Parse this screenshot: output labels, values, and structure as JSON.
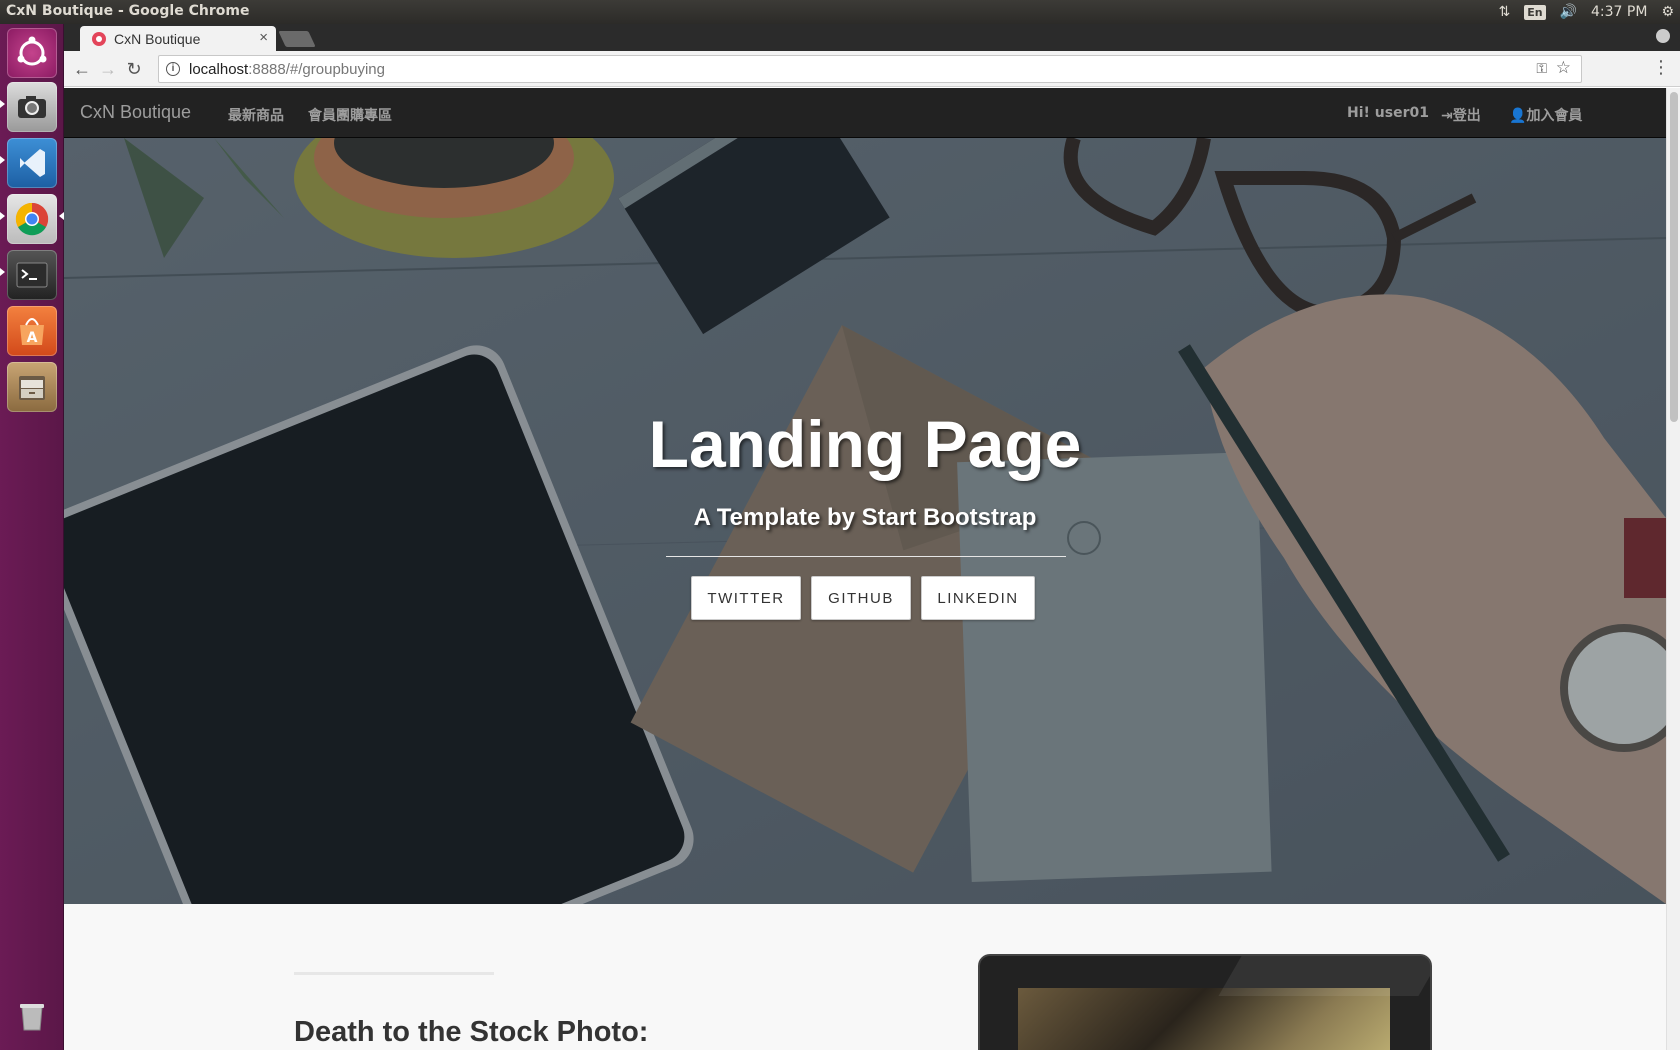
{
  "os": {
    "window_title": "CxN Boutique - Google Chrome",
    "indicators": {
      "lang": "En",
      "clock": "4:37 PM"
    },
    "launcher_apps": [
      "ubuntu-dash",
      "screenshot-tool",
      "vscode",
      "chrome",
      "terminal",
      "software-center",
      "file-manager",
      "trash"
    ]
  },
  "browser": {
    "tab_title": "CxN Boutique",
    "tab_close": "×",
    "url_host": "localhost",
    "url_rest": ":8888/#/groupbuying"
  },
  "site": {
    "brand": "CxN Boutique",
    "nav_left": [
      "最新商品",
      "會員團購專區"
    ],
    "greeting": "Hi! user01",
    "logout": "登出",
    "join": "加入會員"
  },
  "hero": {
    "title": "Landing Page",
    "subtitle": "A Template by Start Bootstrap",
    "buttons": [
      "TWITTER",
      "GITHUB",
      "LINKEDIN"
    ]
  },
  "content": {
    "heading": "Death to the Stock Photo:"
  },
  "colors": {
    "navbar_bg": "#222222",
    "nav_text": "#9d9d9d",
    "launcher": "#6b1b55",
    "hero_overlay": "#4a5560"
  }
}
